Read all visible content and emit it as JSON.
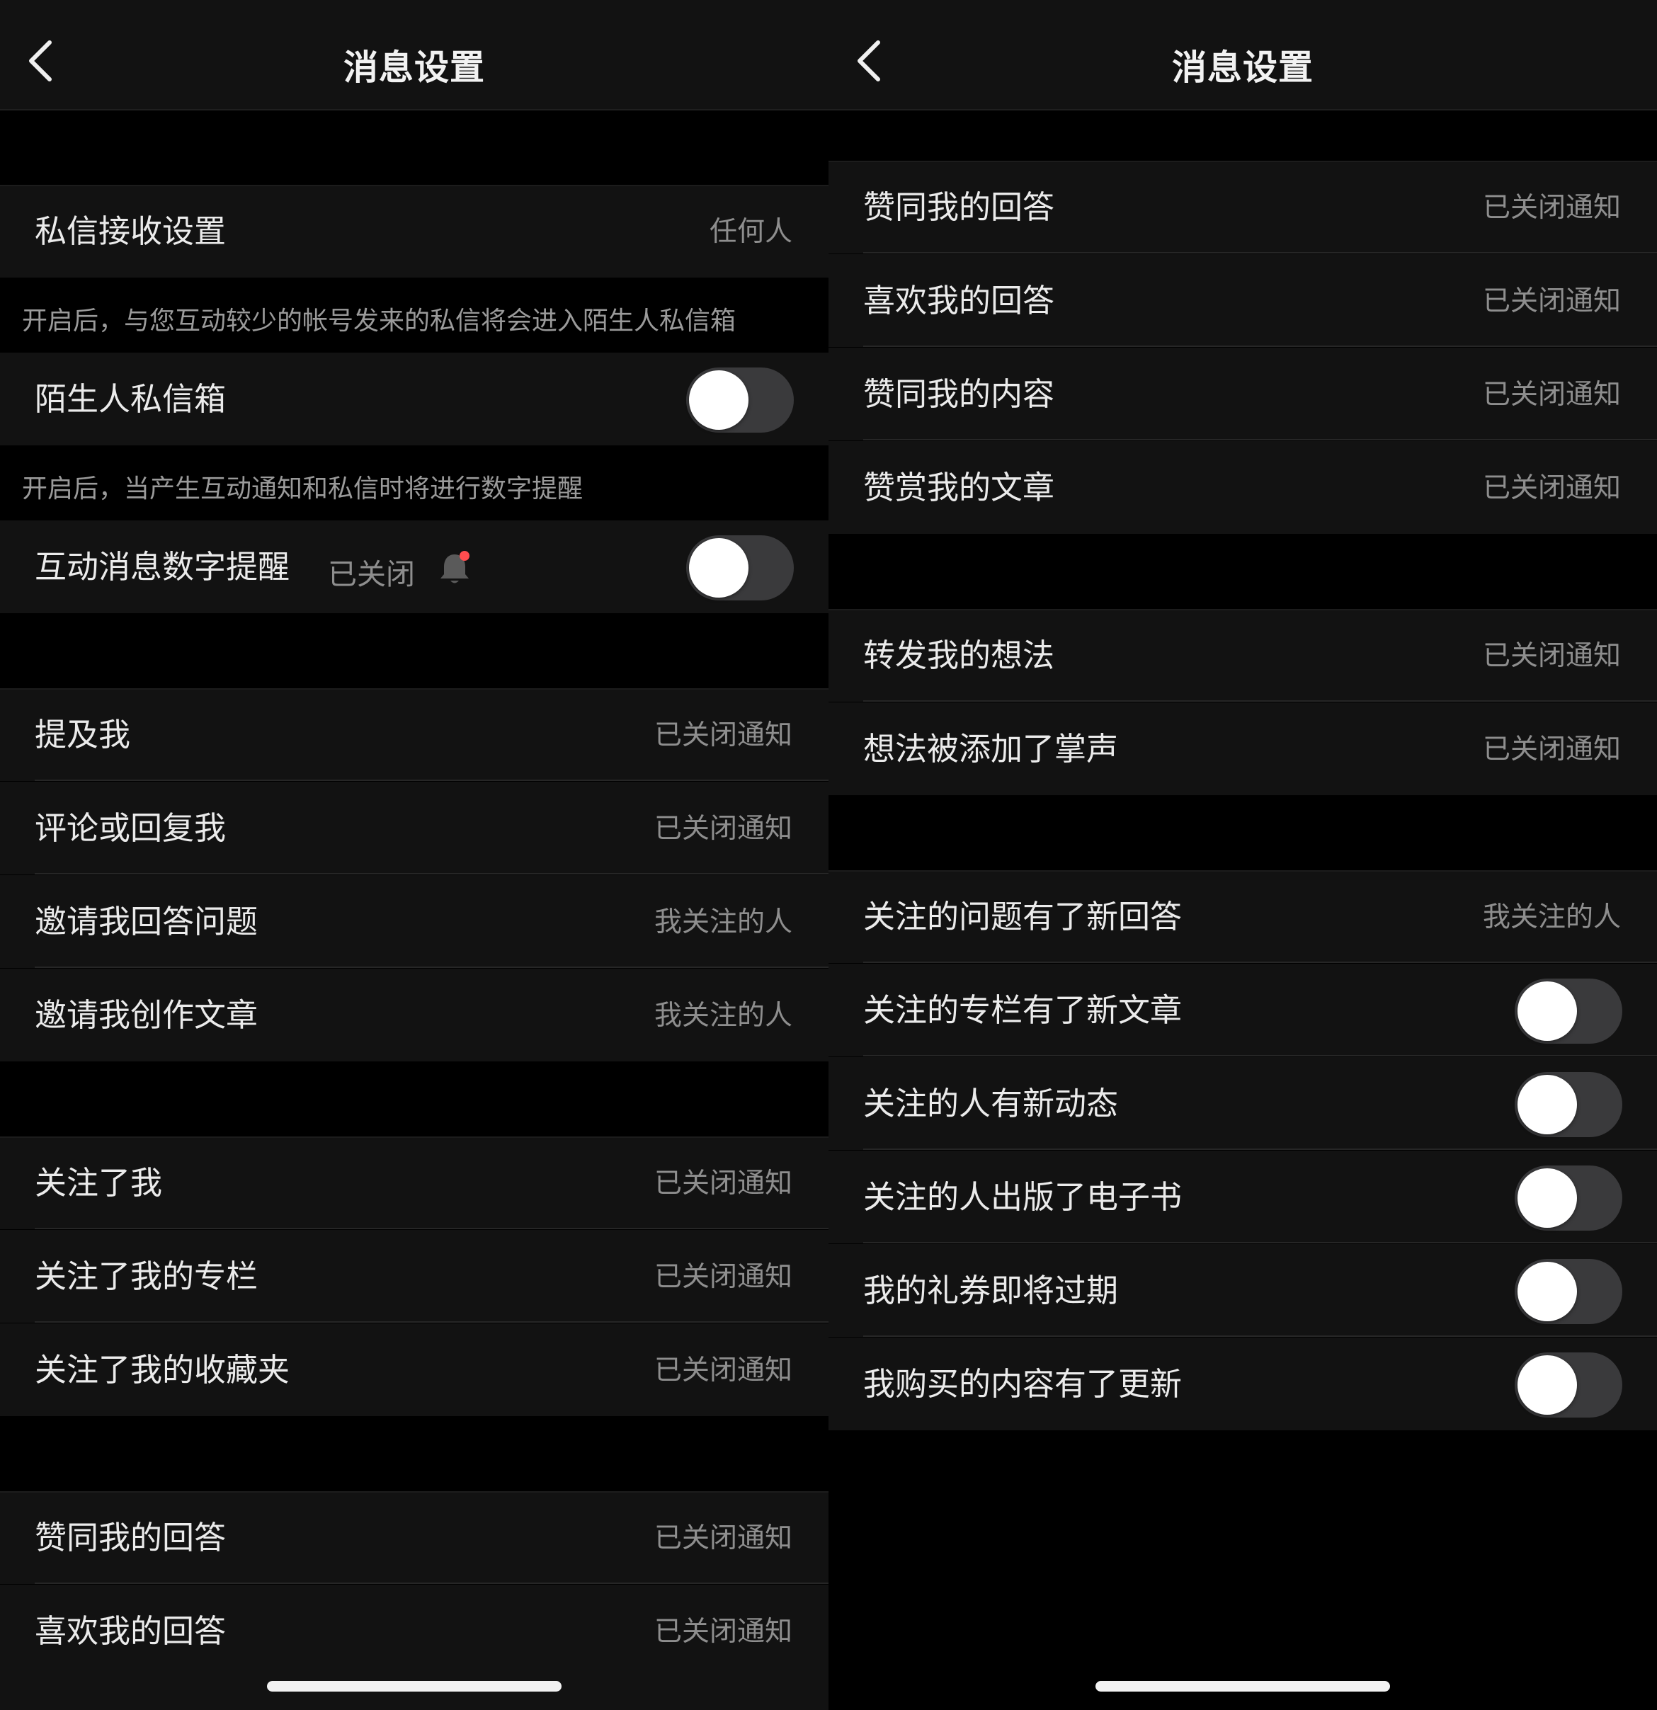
{
  "left_screen": {
    "nav": {
      "title": "消息设置"
    },
    "dm_settings": {
      "label": "私信接收设置",
      "value": "任何人"
    },
    "dm_note": "开启后，与您互动较少的帐号发来的私信将会进入陌生人私信箱",
    "stranger_box": {
      "label": "陌生人私信箱",
      "enabled": false
    },
    "badge_note": "开启后，当产生互动通知和私信时将进行数字提醒",
    "badge_reminder": {
      "label": "互动消息数字提醒",
      "status": "已关闭",
      "enabled": false,
      "icon": "bell-icon",
      "dot_color": "#ff4d4f"
    },
    "group1": [
      {
        "label": "提及我",
        "value": "已关闭通知"
      },
      {
        "label": "评论或回复我",
        "value": "已关闭通知"
      },
      {
        "label": "邀请我回答问题",
        "value": "我关注的人"
      },
      {
        "label": "邀请我创作文章",
        "value": "我关注的人"
      }
    ],
    "group2": [
      {
        "label": "关注了我",
        "value": "已关闭通知"
      },
      {
        "label": "关注了我的专栏",
        "value": "已关闭通知"
      },
      {
        "label": "关注了我的收藏夹",
        "value": "已关闭通知"
      }
    ],
    "group3": [
      {
        "label": "赞同我的回答",
        "value": "已关闭通知"
      },
      {
        "label": "喜欢我的回答",
        "value": "已关闭通知"
      }
    ]
  },
  "right_screen": {
    "nav": {
      "title": "消息设置"
    },
    "group1": [
      {
        "label": "赞同我的回答",
        "value": "已关闭通知"
      },
      {
        "label": "喜欢我的回答",
        "value": "已关闭通知"
      },
      {
        "label": "赞同我的内容",
        "value": "已关闭通知"
      },
      {
        "label": "赞赏我的文章",
        "value": "已关闭通知"
      }
    ],
    "group2": [
      {
        "label": "转发我的想法",
        "value": "已关闭通知"
      },
      {
        "label": "想法被添加了掌声",
        "value": "已关闭通知"
      }
    ],
    "group3_first": {
      "label": "关注的问题有了新回答",
      "value": "我关注的人"
    },
    "group3_toggles": [
      {
        "label": "关注的专栏有了新文章",
        "enabled": false
      },
      {
        "label": "关注的人有新动态",
        "enabled": false
      },
      {
        "label": "关注的人出版了电子书",
        "enabled": false
      },
      {
        "label": "我的礼券即将过期",
        "enabled": false
      },
      {
        "label": "我购买的内容有了更新",
        "enabled": false
      }
    ]
  },
  "colors": {
    "background": "#000000",
    "row_bg": "#121212",
    "text": "#ebebeb",
    "secondary": "#8e8e8e",
    "toggle_off": "#3a3a3c"
  }
}
